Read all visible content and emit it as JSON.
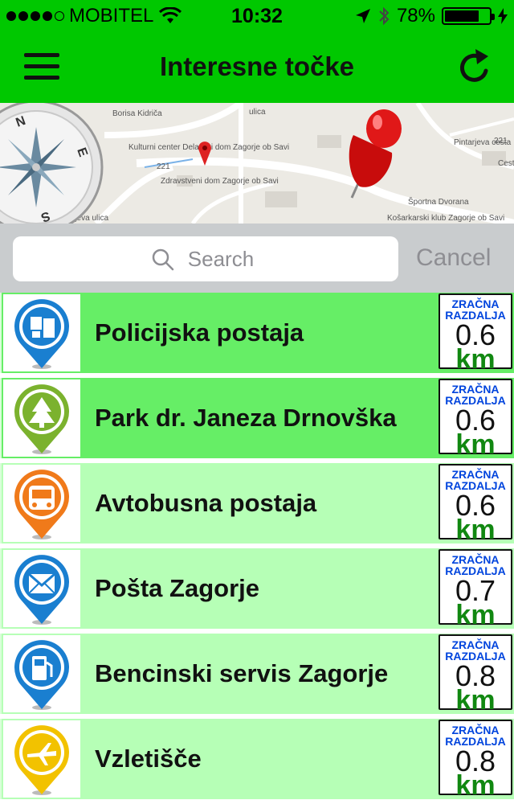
{
  "status": {
    "carrier": "MOBITEL",
    "time": "10:32",
    "battery": "78%",
    "battery_level": 0.78,
    "signal_bars": 4,
    "icons": [
      "signal-dots-icon",
      "wifi-icon",
      "location-arrow-icon",
      "bluetooth-icon",
      "battery-icon",
      "charging-bolt-icon"
    ]
  },
  "nav": {
    "title": "Interesne točke",
    "menu_icon": "hamburger-menu-icon",
    "refresh_icon": "refresh-icon"
  },
  "map": {
    "labels": [
      "Borisa Kidriča",
      "Kulturni center Delavski dom Zagorje ob Savi",
      "221",
      "Zdravstveni dom Zagorje ob Savi",
      "ulica",
      "Pintarjeva cesta",
      "221",
      "Cesta",
      "Športna Dvorana",
      "Košarkarski klub Zagorje ob Savi",
      "rjeva ulica"
    ],
    "compass_letters": [
      "N",
      "E",
      "S"
    ]
  },
  "search": {
    "placeholder": "Search",
    "cancel": "Cancel"
  },
  "distance_caption": [
    "ZRAČNA",
    "RAZDALJA"
  ],
  "distance_unit": "km",
  "colors": {
    "header_green": "#00c800",
    "row_selected": "#66ee66",
    "row_default": "#b6ffb6",
    "distance_caption": "#0044dd",
    "distance_unit": "#118811"
  },
  "items": [
    {
      "name": "Policijska postaja",
      "distance": "0.6",
      "icon": "police-pin-icon",
      "pin_color": "#1a7fd0",
      "highlight": true
    },
    {
      "name": "Park dr. Janeza Drnovška",
      "distance": "0.6",
      "icon": "park-tree-pin-icon",
      "pin_color": "#7bb22e",
      "highlight": true
    },
    {
      "name": "Avtobusna postaja",
      "distance": "0.6",
      "icon": "bus-pin-icon",
      "pin_color": "#f07a1a",
      "highlight": false
    },
    {
      "name": "Pošta Zagorje",
      "distance": "0.7",
      "icon": "post-office-pin-icon",
      "pin_color": "#1a7fd0",
      "highlight": false
    },
    {
      "name": "Bencinski servis Zagorje",
      "distance": "0.8",
      "icon": "gas-station-pin-icon",
      "pin_color": "#1a7fd0",
      "highlight": false
    },
    {
      "name": "Vzletišče",
      "distance": "0.8",
      "icon": "airport-pin-icon",
      "pin_color": "#f2c200",
      "highlight": false
    }
  ]
}
